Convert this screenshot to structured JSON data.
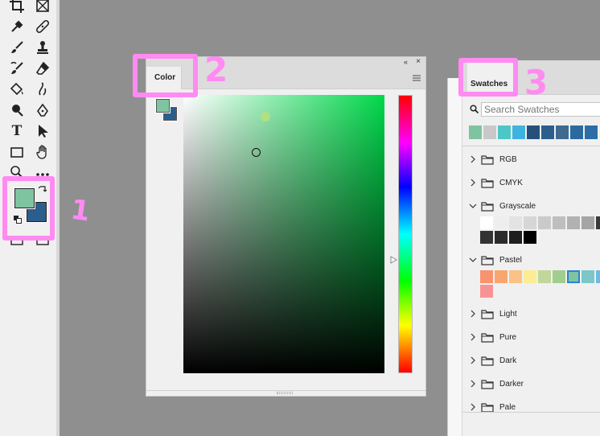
{
  "colors": {
    "foreground": "#7fc4a0",
    "background": "#2b5e8c",
    "marker": "#ff8bf2",
    "selection": "#2a82d9"
  },
  "toolbar": {
    "tools": [
      "crop-icon",
      "frame-icon",
      "eyedropper-icon",
      "healing-brush-icon",
      "brush-icon",
      "clone-stamp-icon",
      "history-brush-icon",
      "eraser-icon",
      "paint-bucket-icon",
      "smudge-icon",
      "dodge-icon",
      "pen-icon",
      "type-icon",
      "path-selection-icon",
      "rectangle-icon",
      "hand-icon",
      "zoom-icon",
      "more-icon"
    ],
    "type_glyph": "T"
  },
  "markers": {
    "one": "1",
    "two": "2",
    "three": "3"
  },
  "color_panel": {
    "tab_label": "Color",
    "collapse_glyph": "«",
    "close_glyph": "×"
  },
  "swatches_panel": {
    "tab_label": "Swatches",
    "search_placeholder": "Search Swatches",
    "recent": [
      "#7fc4a0",
      "#c8c8c8",
      "#4dc6c8",
      "#3fb3e0",
      "#264f7a",
      "#2b5e8c",
      "#3e6a8f",
      "#2a6aa1",
      "#2c6da6"
    ],
    "groups": [
      {
        "label": "RGB",
        "open": false
      },
      {
        "label": "CMYK",
        "open": false
      },
      {
        "label": "Grayscale",
        "open": true,
        "colors": [
          "#ffffff",
          "#eeeeee",
          "#e3e3e3",
          "#d6d6d6",
          "#cacaca",
          "#bebebe",
          "#b1b1b1",
          "#a5a5a5",
          "#3a3a3a",
          "#333333",
          "#2b2b2b",
          "#1e1e1e",
          "#000000"
        ]
      },
      {
        "label": "Pastel",
        "open": true,
        "colors": [
          "#f9936e",
          "#f9a66e",
          "#fbc285",
          "#fcec92",
          "#c1d79a",
          "#a0ce8e",
          "#7fc4a0",
          "#7cc7c8",
          "#6fb9e6",
          "#f99393"
        ]
      },
      {
        "label": "Light",
        "open": false
      },
      {
        "label": "Pure",
        "open": false
      },
      {
        "label": "Dark",
        "open": false
      },
      {
        "label": "Darker",
        "open": false
      },
      {
        "label": "Pale",
        "open": false
      }
    ]
  }
}
